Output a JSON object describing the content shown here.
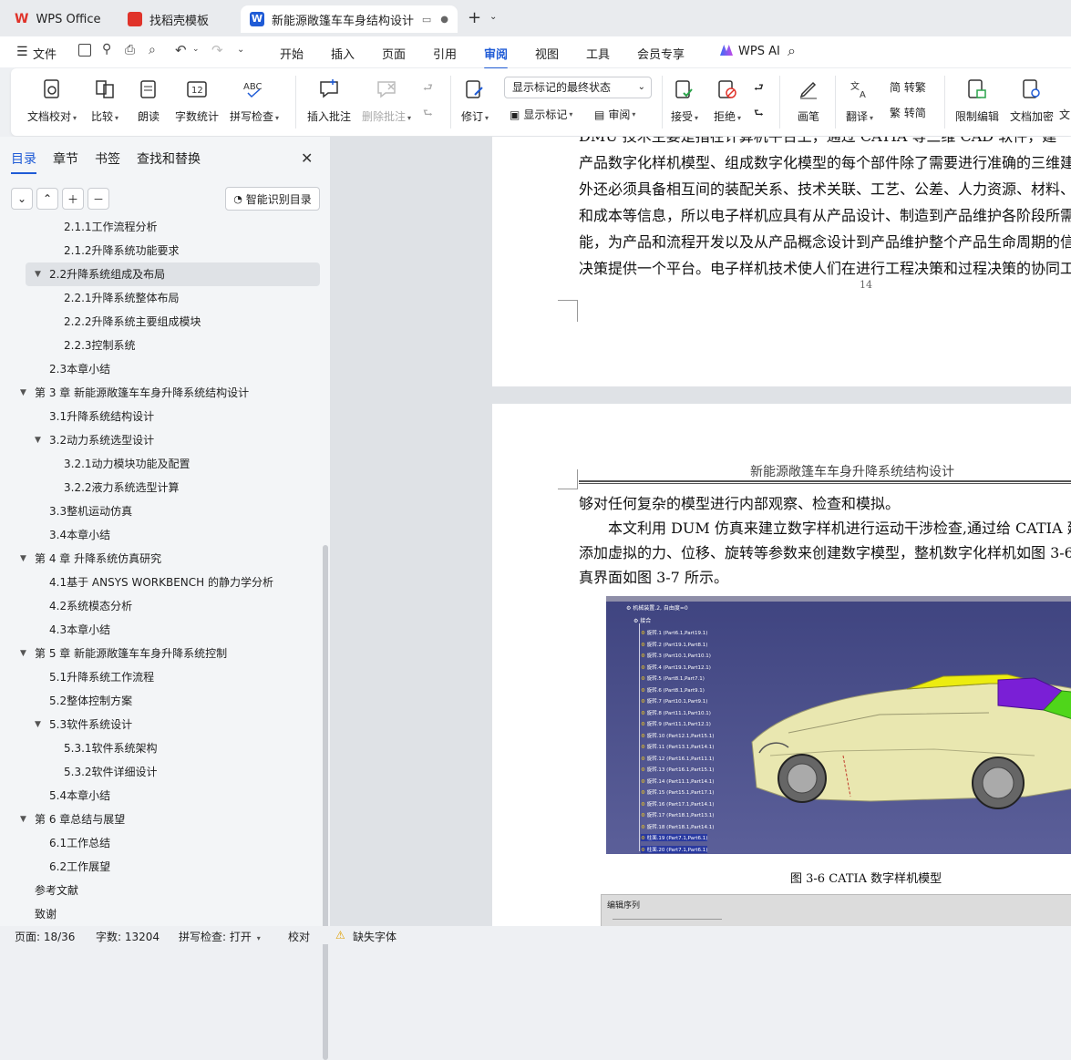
{
  "tabs": [
    {
      "label": "WPS Office"
    },
    {
      "label": "找稻壳模板"
    },
    {
      "label": "新能源敞篷车车身结构设计 毕"
    }
  ],
  "new_tab": "+",
  "menu": {
    "file": "文件",
    "items": [
      "开始",
      "插入",
      "页面",
      "引用",
      "审阅",
      "视图",
      "工具",
      "会员专享"
    ],
    "active": "审阅",
    "wps_ai": "WPS AI"
  },
  "ribbon": {
    "proof": "文档校对",
    "compare": "比较",
    "read": "朗读",
    "wordcount": "字数统计",
    "spell": "拼写检查",
    "add_comment": "插入批注",
    "delete_comment": "删除批注",
    "revise": "修订",
    "markup_select": "显示标记的最终状态",
    "show_markup": "显示标记",
    "review": "审阅",
    "accept": "接受",
    "reject": "拒绝",
    "pen": "画笔",
    "translate": "翻译",
    "to_trad": "简 转繁",
    "to_simp": "繁 转简",
    "restrict": "限制编辑",
    "encrypt": "文档加密",
    "more": "文"
  },
  "sidebar": {
    "tabs": [
      "目录",
      "章节",
      "书签",
      "查找和替换"
    ],
    "active_tab": "目录",
    "smart_btn": "智能识别目录",
    "toc": [
      {
        "t": "2.1.1工作流程分析",
        "lvl": 3
      },
      {
        "t": "2.1.2升降系统功能要求",
        "lvl": 3
      },
      {
        "t": "2.2升降系统组成及布局",
        "lvl": 2,
        "exp": true,
        "sel": true
      },
      {
        "t": "2.2.1升降系统整体布局",
        "lvl": 3
      },
      {
        "t": "2.2.2升降系统主要组成模块",
        "lvl": 3
      },
      {
        "t": "2.2.3控制系统",
        "lvl": 3
      },
      {
        "t": "2.3本章小结",
        "lvl": 2
      },
      {
        "t": "第 3 章 新能源敞篷车车身升降系统结构设计",
        "lvl": 1,
        "exp": true
      },
      {
        "t": "3.1升降系统结构设计",
        "lvl": 2
      },
      {
        "t": "3.2动力系统选型设计",
        "lvl": 2,
        "exp": true
      },
      {
        "t": "3.2.1动力模块功能及配置",
        "lvl": 3
      },
      {
        "t": "3.2.2液力系统选型计算",
        "lvl": 3
      },
      {
        "t": "3.3整机运动仿真",
        "lvl": 2
      },
      {
        "t": "3.4本章小结",
        "lvl": 2
      },
      {
        "t": "第 4 章 升降系统仿真研究",
        "lvl": 1,
        "exp": true
      },
      {
        "t": "4.1基于 ANSYS WORKBENCH 的静力学分析",
        "lvl": 2
      },
      {
        "t": "4.2系统模态分析",
        "lvl": 2
      },
      {
        "t": "4.3本章小结",
        "lvl": 2
      },
      {
        "t": "第 5 章 新能源敞篷车车身升降系统控制",
        "lvl": 1,
        "exp": true
      },
      {
        "t": "5.1升降系统工作流程",
        "lvl": 2
      },
      {
        "t": "5.2整体控制方案",
        "lvl": 2
      },
      {
        "t": "5.3软件系统设计",
        "lvl": 2,
        "exp": true
      },
      {
        "t": "5.3.1软件系统架构",
        "lvl": 3
      },
      {
        "t": "5.3.2软件详细设计",
        "lvl": 3
      },
      {
        "t": "5.4本章小结",
        "lvl": 2
      },
      {
        "t": "第 6 章总结与展望",
        "lvl": 1,
        "exp": true
      },
      {
        "t": "6.1工作总结",
        "lvl": 2
      },
      {
        "t": "6.2工作展望",
        "lvl": 2
      },
      {
        "t": "参考文献",
        "lvl": 1
      },
      {
        "t": "致谢",
        "lvl": 1
      }
    ]
  },
  "doc": {
    "p1_lines": [
      "DMU 技术主要是指在计算机平台上，通过 CATIA 等三维 CAD 软件，建",
      "产品数字化样机模型、组成数字化模型的每个部件除了需要进行准确的三维建",
      "外还必须具备相互间的装配关系、技术关联、工艺、公差、人力资源、材料、",
      "和成本等信息，所以电子样机应具有从产品设计、制造到产品维护各阶段所需",
      "能，为产品和流程开发以及从产品概念设计到产品维护整个产品生命周期的信",
      "决策提供一个平台。电子样机技术使人们在进行工程决策和过程决策的协同工"
    ],
    "page_num": "14",
    "header": "新能源敞篷车车身升降系统结构设计",
    "p2_lines": [
      "够对任何复杂的模型进行内部观察、检查和模拟。",
      "本文利用 DUM 仿真来建立数字样机进行运动干涉检查,通过给 CATIA 建",
      "添加虚拟的力、位移、旋转等参数来创建数字模型，整机数字化样机如图 3-6",
      "真界面如图 3-7 所示。"
    ],
    "fig_tree_root": "机械装置.2, 自由度=0",
    "fig_tree_group": "接合",
    "fig_tree": [
      "旋转.1 (Part6.1,Part19.1)",
      "旋转.2 (Part19.1,Part8.1)",
      "旋转.3 (Part10.1,Part10.1)",
      "旋转.4 (Part19.1,Part12.1)",
      "旋转.5 (Part8.1,Part7.1)",
      "旋转.6 (Part8.1,Part9.1)",
      "旋转.7 (Part10.1,Part9.1)",
      "旋转.8 (Part11.1,Part10.1)",
      "旋转.9 (Part11.1,Part12.1)",
      "旋转.10 (Part12.1,Part15.1)",
      "旋转.11 (Part13.1,Part14.1)",
      "旋转.12 (Part16.1,Part11.1)",
      "旋转.13 (Part16.1,Part15.1)",
      "旋转.14 (Part11.1,Part14.1)",
      "旋转.15 (Part15.1,Part17.1)",
      "旋转.16 (Part17.1,Part14.1)",
      "旋转.17 (Part18.1,Part13.1)",
      "旋转.18 (Part18.1,Part14.1)",
      "柱面.19 (Part7.1,Part6.1)",
      "柱面.20 (Part7.1,Part6.1)"
    ],
    "caption": "图 3-6 CATIA 数字样机模型",
    "fig2_title": "编辑序列",
    "fig2_help": "?"
  },
  "status": {
    "page": "页面: 18/36",
    "words": "字数: 13204",
    "spell": "拼写检查: 打开",
    "proof": "校对",
    "missing_font": "缺失字体"
  },
  "colors": {
    "accent": "#1f5bd6",
    "catia_bg": "#4a4f8a",
    "car_body": "#e9e7b0",
    "roof_yellow": "#ecec10",
    "roof_purple": "#7a1fd6",
    "roof_green": "#4fd61a"
  }
}
